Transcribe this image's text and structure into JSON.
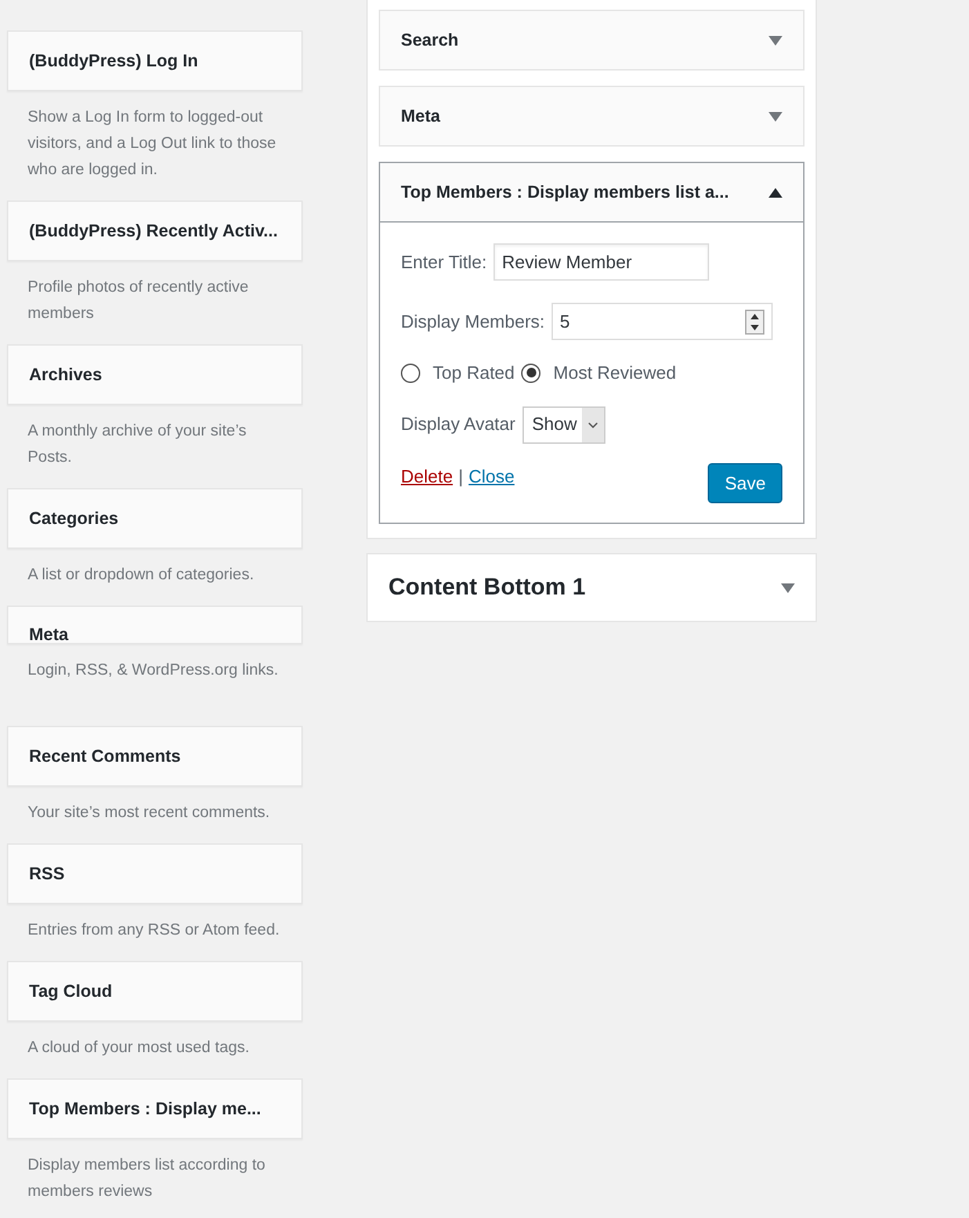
{
  "available_widgets": [
    {
      "kind": "full",
      "title": "(BuddyPress) Log In",
      "description": "Show a Log In form to logged-out visitors, and a Log Out link to those who are logged in."
    },
    {
      "kind": "full",
      "title": "(BuddyPress) Recently Activ...",
      "description": "Profile photos of recently active members"
    },
    {
      "kind": "full",
      "title": "Archives",
      "description": "A monthly archive of your site’s Posts."
    },
    {
      "kind": "full",
      "title": "Categories",
      "description": "A list or dropdown of categories."
    },
    {
      "kind": "cut",
      "title": "Meta",
      "description": "Login, RSS, & WordPress.org links."
    },
    {
      "kind": "full",
      "title": "Recent Comments",
      "description": "Your site’s most recent comments."
    },
    {
      "kind": "full",
      "title": "RSS",
      "description": "Entries from any RSS or Atom feed."
    },
    {
      "kind": "full",
      "title": "Tag Cloud",
      "description": "A cloud of your most used tags."
    },
    {
      "kind": "full",
      "title": "Top Members : Display me...",
      "description": "Display members list according to members reviews"
    }
  ],
  "sidebar_widgets": [
    {
      "title": "Search",
      "expanded": false
    },
    {
      "title": "Meta",
      "expanded": false
    },
    {
      "title": "Top Members : Display members list a...",
      "expanded": true
    }
  ],
  "widget_form": {
    "title_label": "Enter Title:",
    "title_value": "Review Member",
    "members_label": "Display Members:",
    "members_value": "5",
    "radios": [
      {
        "label": "Top Rated",
        "selected": false
      },
      {
        "label": "Most Reviewed",
        "selected": true
      }
    ],
    "avatar_label": "Display Avatar",
    "avatar_value": "Show",
    "delete_link": "Delete",
    "separator": "|",
    "close_link": "Close",
    "save_button": "Save"
  },
  "next_sidebar": {
    "title": "Content Bottom 1",
    "expanded": false
  }
}
